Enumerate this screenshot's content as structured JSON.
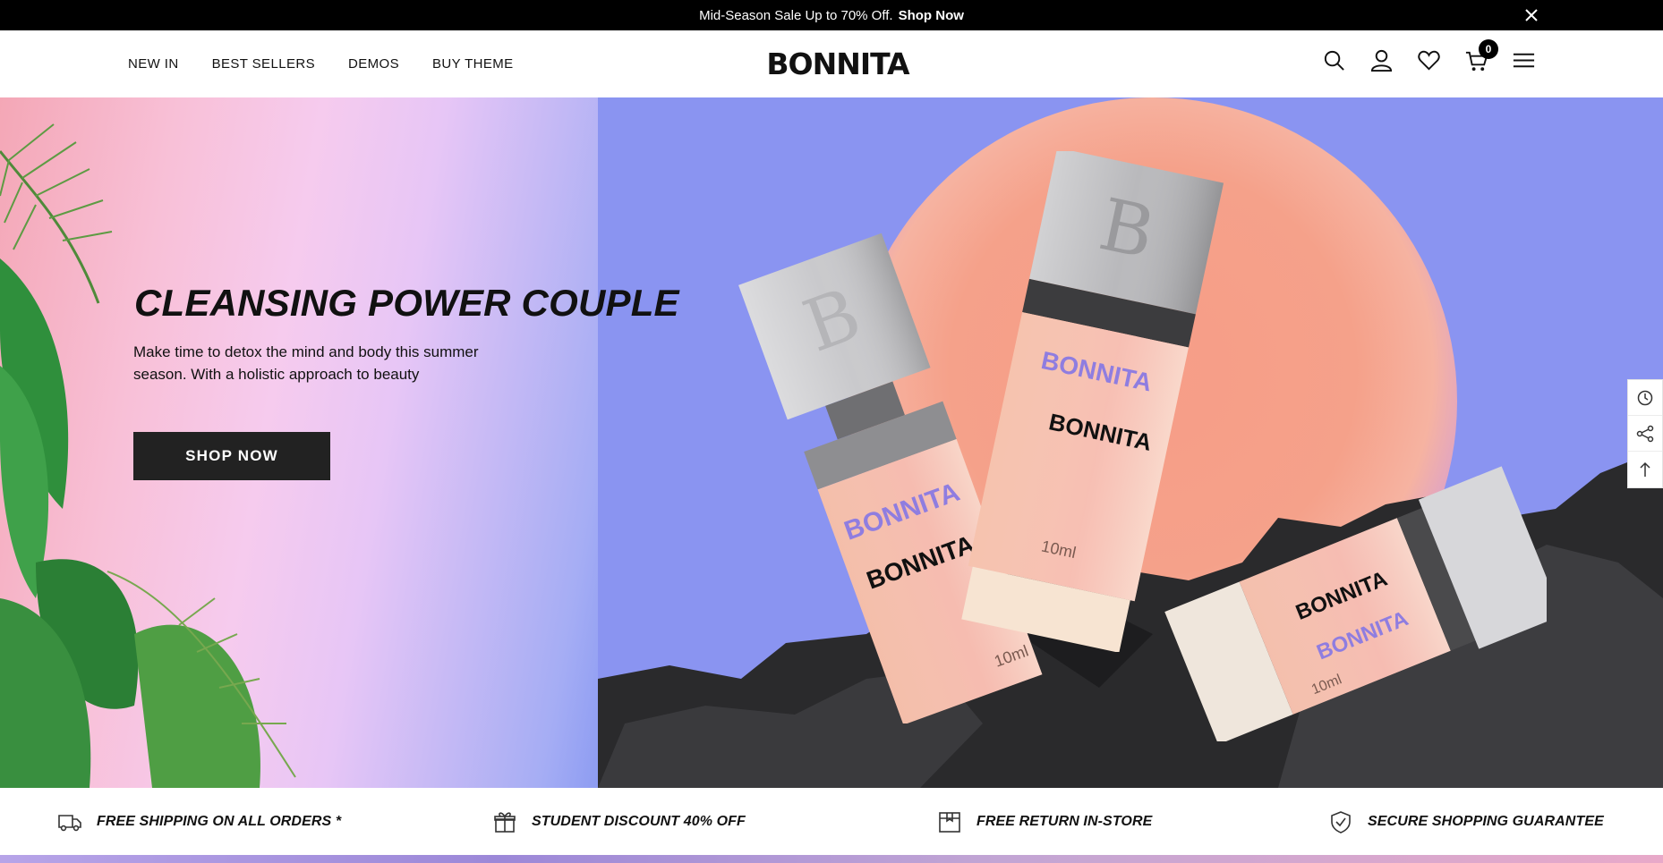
{
  "announcement": {
    "text": "Mid-Season Sale Up to 70% Off.",
    "link": "Shop Now",
    "close_icon": "close-icon"
  },
  "header": {
    "nav": [
      {
        "label": "NEW IN"
      },
      {
        "label": "BEST SELLERS"
      },
      {
        "label": "DEMOS"
      },
      {
        "label": "BUY THEME"
      }
    ],
    "logo": "BONNITA",
    "icons": [
      "search-icon",
      "account-icon",
      "wishlist-icon",
      "cart-icon",
      "menu-icon"
    ],
    "cart_count": "0"
  },
  "hero": {
    "title": "CLEANSING POWER COUPLE",
    "subtitle": "Make time to detox the mind and body this summer season. With a holistic approach to beauty",
    "cta": "SHOP NOW",
    "product_text": {
      "brand": "BONNITA",
      "size": "10ml",
      "cap_letter": "B"
    }
  },
  "side_tools": [
    "recently-viewed-icon",
    "share-icon",
    "back-to-top-icon"
  ],
  "features": [
    {
      "icon": "truck-icon",
      "label": "FREE SHIPPING ON ALL ORDERS *"
    },
    {
      "icon": "gift-icon",
      "label": "STUDENT DISCOUNT 40% OFF"
    },
    {
      "icon": "box-icon",
      "label": "FREE RETURN IN-STORE"
    },
    {
      "icon": "shield-check-icon",
      "label": "SECURE SHOPPING GUARANTEE"
    }
  ],
  "colors": {
    "announcement_bg": "#000000",
    "button_bg": "#222222",
    "hero_right_bg": "#8a94f1",
    "sun": "#f79d87"
  }
}
